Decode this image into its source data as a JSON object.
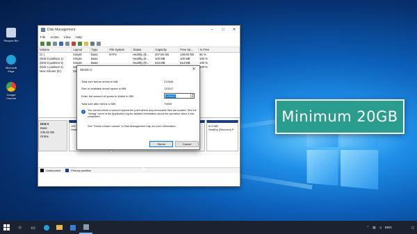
{
  "desktop": {
    "icons": [
      {
        "label": "Recycle Bin",
        "icon": "recycle-bin-icon",
        "color": "#c9d6e6"
      },
      {
        "label": "Microsoft Edge",
        "icon": "edge-icon",
        "color": "#1fa2d8"
      },
      {
        "label": "Google Chrome",
        "icon": "chrome-icon",
        "color": "#e94235"
      }
    ]
  },
  "window": {
    "title": "Disk Management",
    "menu": [
      "File",
      "Action",
      "View",
      "Help"
    ],
    "columns": [
      "Volume",
      "Layout",
      "Type",
      "File System",
      "Status",
      "Capacity",
      "Free Sp...",
      "% Free"
    ],
    "rows": [
      [
        "(C:)",
        "Simple",
        "Basic",
        "NTFS",
        "Healthy (B...",
        "207.86 GB",
        "138.09 GB",
        "65 %"
      ],
      [
        "(Disk 0 partition 1)",
        "Simple",
        "Basic",
        "",
        "Healthy (E...",
        "100 MB",
        "100 MB",
        "100 %"
      ],
      [
        "(Disk 0 partition 5)",
        "Simple",
        "Basic",
        "",
        "Healthy (R...",
        "513 MB",
        "513 MB",
        "100 %"
      ],
      [
        "(Disk 1 partition 2)",
        "Simple",
        "Basic",
        "",
        "Healthy (R...",
        "100 MB",
        "100 MB",
        "100 %"
      ],
      [
        "New Volume (E:)",
        "Simple",
        "Basic",
        "NTFS",
        "Healthy (B...",
        "",
        "",
        ""
      ]
    ],
    "disk": {
      "name": "Disk 0",
      "type": "Basic",
      "size": "238.46 GB",
      "state": "Online",
      "partitions": [
        {
          "size": "100 MB",
          "status": "Healthy"
        },
        {
          "size": "513 MB",
          "status": "Healthy (Recovery P"
        }
      ]
    },
    "legend": [
      "Unallocated",
      "Primary partition"
    ]
  },
  "dialog": {
    "title": "Shrink C:",
    "total_before_label": "Total size before shrink in MB:",
    "total_before_value": "212846",
    "available_label": "Size of available shrink space in MB:",
    "available_value": "133247",
    "enter_label": "Enter the amount of space to shrink in MB:",
    "enter_value": "133247",
    "after_label": "Total size after shrink in MB:",
    "after_value": "79599",
    "info_text": "You cannot shrink a volume beyond the point where any unmovable files are located. See the \"defrag\" event in the Application log for detailed information about the operation when it has completed.",
    "help_text": "See \"Shrink a basic volume\" in Disk Management help for more information",
    "shrink_label": "Shrink",
    "cancel_label": "Cancel"
  },
  "banner": {
    "text": "Minimum 20GB",
    "color": "#2a9d8f"
  },
  "taskbar": {
    "language": "ENG"
  }
}
